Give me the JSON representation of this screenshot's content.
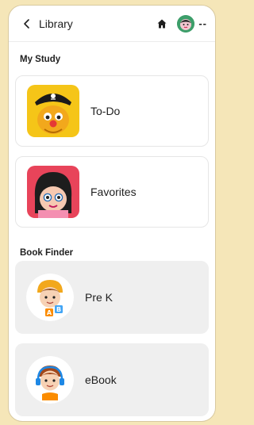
{
  "header": {
    "back_label": "Library",
    "avatar_text": "--",
    "icons": [
      "chevron-left-icon",
      "home-icon",
      "avatar"
    ]
  },
  "my_study": {
    "label": "My Study",
    "items": [
      {
        "label": "To-Do",
        "icon": "pirate-character-icon"
      },
      {
        "label": "Favorites",
        "icon": "girl-character-icon"
      }
    ]
  },
  "book_finder": {
    "label": "Book Finder",
    "items": [
      {
        "label": "Pre K",
        "icon": "boy-with-blocks-icon"
      },
      {
        "label": "eBook",
        "icon": "boy-with-headphones-icon"
      }
    ]
  },
  "colors": {
    "background": "#f5e6b8",
    "card_gray": "#efefef",
    "todo_thumb": "#f5c518",
    "favorites_thumb": "#e8445a"
  }
}
